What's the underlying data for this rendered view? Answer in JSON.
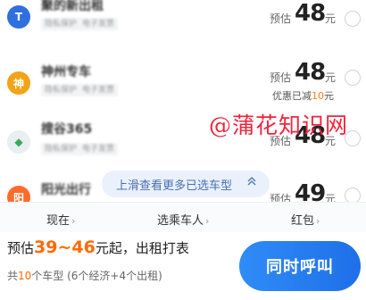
{
  "options": {
    "time": {
      "label": "现在",
      "arrow": "›"
    },
    "passenger": {
      "label": "选乘车人",
      "arrow": "›"
    },
    "coupon": {
      "label": "红包",
      "arrow": "›"
    }
  },
  "rides": [
    {
      "name": "聚的新出租",
      "logo_text": "T",
      "logo_color": "#2f6fe0",
      "tags": [
        "隐私保护",
        "电子发票"
      ],
      "estimate_label": "预估",
      "price": "48",
      "unit": "元",
      "discount": null
    },
    {
      "name": "神州专车",
      "logo_text": "神",
      "logo_color": "#f2a416",
      "tags": [
        "隐私保护",
        "电子发票"
      ],
      "estimate_label": "预估",
      "price": "48",
      "unit": "元",
      "discount": {
        "prefix": "优惠已减",
        "amount": "10",
        "suffix": "元"
      }
    },
    {
      "name": "搜谷365",
      "logo_text": "◆",
      "logo_color": "#e9eef0",
      "tags": [
        "隐私保护",
        "电子发票"
      ],
      "estimate_label": "预估",
      "price": "48",
      "unit": "元",
      "discount": null
    },
    {
      "name": "阳光出行",
      "logo_text": "阳",
      "logo_color": "#ff6b2a",
      "tags": [],
      "estimate_label": "预估",
      "price": "49",
      "unit": "元",
      "discount": null
    }
  ],
  "watermark": "@蒲花知识网",
  "slide_hint": {
    "text": "上滑查看更多已选车型",
    "icon": "chevron-up-icon"
  },
  "summary": {
    "prefix": "预估",
    "range": "39~46",
    "suffix": "元起，出租打表",
    "count_prefix": "共",
    "count": "10",
    "count_suffix": "个车型 (6个经济+4个出租)"
  },
  "call_button": {
    "label": "同时呼叫",
    "color": "#2f8cf8"
  }
}
